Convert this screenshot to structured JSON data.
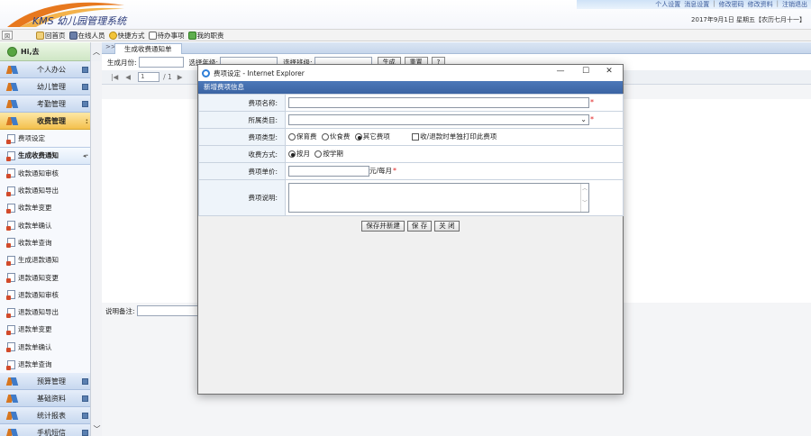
{
  "app": {
    "logo_text": "KMS 幼儿园管理系统",
    "top_links": [
      "个人设置",
      "消息设置",
      "修改密码",
      "修改资料",
      "注销退出"
    ],
    "date_line": "2017年9月1日 星期五【农历七月十一】"
  },
  "toolbar": {
    "toggle": "図",
    "items": [
      {
        "label": "回首页",
        "icon": "home-icon"
      },
      {
        "label": "在线人员",
        "icon": "users-icon"
      },
      {
        "label": "快捷方式",
        "icon": "shortcut-icon"
      },
      {
        "label": "待办事项",
        "icon": "todo-icon"
      },
      {
        "label": "我的职责",
        "icon": "duty-icon"
      }
    ]
  },
  "sidebar": {
    "user": "Hi,去",
    "groups": [
      {
        "label": "个人办公"
      },
      {
        "label": "幼儿管理"
      },
      {
        "label": "考勤管理"
      },
      {
        "label": "收费管理"
      }
    ],
    "items": [
      {
        "label": "费项设定"
      },
      {
        "label": "生成收费通知"
      },
      {
        "label": "收款通知审核"
      },
      {
        "label": "收款通知导出"
      },
      {
        "label": "收款单变更"
      },
      {
        "label": "收款单确认"
      },
      {
        "label": "收款单查询"
      },
      {
        "label": "生成退款通知"
      },
      {
        "label": "退款通知变更"
      },
      {
        "label": "退款通知审核"
      },
      {
        "label": "退款通知导出"
      },
      {
        "label": "退款单变更"
      },
      {
        "label": "退款单确认"
      },
      {
        "label": "退款单查询"
      }
    ],
    "bottom_groups": [
      {
        "label": "预算管理"
      },
      {
        "label": "基础资料"
      },
      {
        "label": "统计报表"
      },
      {
        "label": "手机短信"
      }
    ]
  },
  "main": {
    "tab_label": "生成收费通知单",
    "filters": {
      "month_label": "生成月份:",
      "year_label": "选择年级:",
      "class_label": "选择班级:",
      "generate_button": "生成",
      "reset_button": "重置",
      "help_button": "?"
    },
    "pager": {
      "page_value": "1",
      "page_total": "/ 1"
    },
    "remark_label": "说明备注:"
  },
  "dialog": {
    "title": "费项设定 - Internet Explorer",
    "minimize": "—",
    "maximize": "☐",
    "close": "✕",
    "section": "新增费项信息",
    "fields": {
      "name_label": "费项名称:",
      "category_label": "所属类目:",
      "type_label": "费项类型:",
      "type_options": [
        "保育费",
        "伙食费",
        "其它费项"
      ],
      "type_checkbox": "收/退款时单独打印此费项",
      "method_label": "收费方式:",
      "method_options": [
        "按月",
        "按学期"
      ],
      "price_label": "费项单价:",
      "price_unit": "元/每月",
      "desc_label": "费项说明:"
    },
    "buttons": {
      "save_new": "保存并新建",
      "save": "保 存",
      "close": "关 闭"
    }
  }
}
